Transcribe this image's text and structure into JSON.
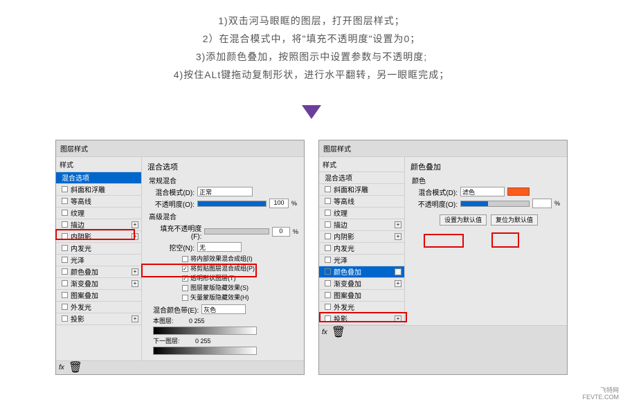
{
  "instructions": {
    "line1": "1)双击河马眼眶的图层，打开图层样式；",
    "line2": "2）在混合模式中，将\"填充不透明度\"设置为0；",
    "line3": "3)添加颜色叠加，按照图示中设置参数与不透明度;",
    "line4": "4)按住ALt键拖动复制形状，进行水平翻转，另一眼眶完成；"
  },
  "hex_label": "#ff4a16",
  "dialog1": {
    "title": "图层样式",
    "styles_header": "样式",
    "styles": [
      {
        "label": "混合选项",
        "selected": true
      },
      {
        "label": "斜面和浮雕",
        "cb": true
      },
      {
        "label": "等高线",
        "cb": true
      },
      {
        "label": "纹理",
        "cb": true
      },
      {
        "label": "描边",
        "cb": true,
        "plus": true
      },
      {
        "label": "内阴影",
        "cb": true,
        "plus": true
      },
      {
        "label": "内发光",
        "cb": true
      },
      {
        "label": "光泽",
        "cb": true
      },
      {
        "label": "颜色叠加",
        "cb": true,
        "plus": true
      },
      {
        "label": "渐变叠加",
        "cb": true,
        "plus": true
      },
      {
        "label": "图案叠加",
        "cb": true
      },
      {
        "label": "外发光",
        "cb": true
      },
      {
        "label": "投影",
        "cb": true,
        "plus": true
      }
    ],
    "right": {
      "section": "混合选项",
      "sub1": "常规混合",
      "blend_mode_label": "混合模式(D):",
      "blend_mode_value": "正常",
      "opacity_label": "不透明度(O):",
      "opacity_value": "100",
      "sub2": "高级混合",
      "fill_opacity_label": "填充不透明度(F):",
      "fill_opacity_value": "0",
      "channels_label": "挖空(N):",
      "channels_value": "无",
      "check1": "将内部效果混合成组(I)",
      "check2": "将剪贴图层混合成组(P)",
      "check3": "透明形状图层(T)",
      "check4": "图层蒙版隐藏效果(S)",
      "check5": "矢量蒙版隐藏效果(H)",
      "blend_if_label": "混合颜色带(E):",
      "blend_if_value": "灰色",
      "this_layer": "本图层:",
      "this_range": "0     255",
      "under_layer": "下一图层:",
      "under_range": "0     255"
    }
  },
  "dialog2": {
    "title": "图层样式",
    "styles_header": "样式",
    "styles": [
      {
        "label": "混合选项"
      },
      {
        "label": "斜面和浮雕",
        "cb": true
      },
      {
        "label": "等高线",
        "cb": true
      },
      {
        "label": "纹理",
        "cb": true
      },
      {
        "label": "描边",
        "cb": true,
        "plus": true
      },
      {
        "label": "内阴影",
        "cb": true,
        "plus": true
      },
      {
        "label": "内发光",
        "cb": true
      },
      {
        "label": "光泽",
        "cb": true
      },
      {
        "label": "颜色叠加",
        "cb": true,
        "checked": true,
        "selected": true,
        "plus": true
      },
      {
        "label": "渐变叠加",
        "cb": true,
        "plus": true
      },
      {
        "label": "图案叠加",
        "cb": true
      },
      {
        "label": "外发光",
        "cb": true
      },
      {
        "label": "投影",
        "cb": true,
        "plus": true
      }
    ],
    "right": {
      "section": "颜色叠加",
      "sub1": "颜色",
      "blend_mode_label": "混合模式(D):",
      "blend_mode_value": "滤色",
      "opacity_label": "不透明度(O):",
      "opacity_value": "",
      "btn_default": "设置为默认值",
      "btn_reset": "复位为默认值"
    }
  },
  "watermark": {
    "l1": "飞特网",
    "l2": "FEVTE.COM"
  }
}
